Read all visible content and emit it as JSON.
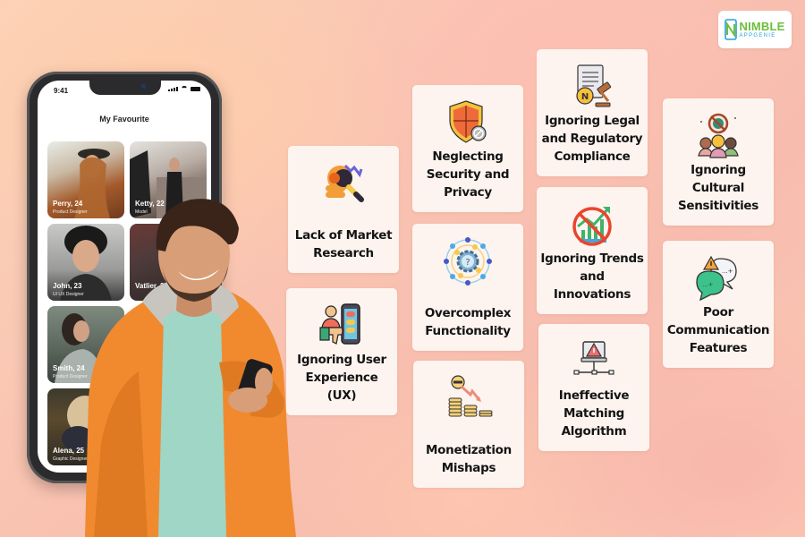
{
  "brand": {
    "name": "NIMBLE",
    "subname": "APPGENIE",
    "colors": {
      "green": "#6bbf3d",
      "blue": "#2a9fd6"
    }
  },
  "phone": {
    "time": "9:41",
    "screen_title": "My Favourite",
    "profiles": [
      {
        "name": "Perry, 24",
        "role": "Product Designer"
      },
      {
        "name": "Ketty, 22",
        "role": "Model"
      },
      {
        "name": "John, 23",
        "role": "UI UX Designer"
      },
      {
        "name": "Vatlier, 21",
        "role": ""
      },
      {
        "name": "Smith, 24",
        "role": "Product Designer"
      },
      {
        "name": "Alena, 25",
        "role": "Graphic Designer"
      }
    ]
  },
  "mistakes": [
    {
      "id": "market-research",
      "label": "Lack of Market Research",
      "icon": "magnifier-coins-icon"
    },
    {
      "id": "ux",
      "label": "Ignoring User Experience (UX)",
      "icon": "user-phone-thumbs-down-icon"
    },
    {
      "id": "security",
      "label": "Neglecting Security and Privacy",
      "icon": "shield-blocked-icon"
    },
    {
      "id": "complexity",
      "label": "Overcomplex Functionality",
      "icon": "gear-question-icon"
    },
    {
      "id": "monetization",
      "label": "Monetization Mishaps",
      "icon": "coins-down-trend-icon"
    },
    {
      "id": "legal",
      "label": "Ignoring Legal and Regulatory Compliance",
      "icon": "document-gavel-icon"
    },
    {
      "id": "trends",
      "label": "Ignoring Trends and Innovations",
      "icon": "no-growth-chart-icon"
    },
    {
      "id": "matching",
      "label": "Ineffective Matching Algorithm",
      "icon": "network-warning-icon"
    },
    {
      "id": "cultural",
      "label": "Ignoring Cultural Sensitivities",
      "icon": "people-no-globe-icon"
    },
    {
      "id": "communication",
      "label": "Poor Communication Features",
      "icon": "chat-warning-icon"
    }
  ]
}
